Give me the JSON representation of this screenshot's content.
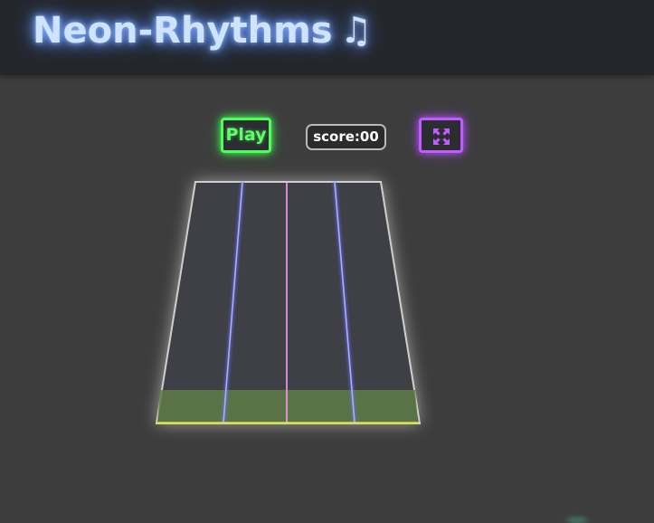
{
  "header": {
    "title": "Neon-Rhythms",
    "note_glyph": "♫"
  },
  "controls": {
    "play_label": "Play",
    "score_label": "score:00",
    "fullscreen_icon": "expand-arrows-icon"
  },
  "colors": {
    "background": "#3d3d3d",
    "header_bg": "#24262b",
    "title_glow": "#6b9cff",
    "play_accent": "#4cff5a",
    "fullscreen_accent": "#c25bff",
    "lane_line_blue": "#8a8dff",
    "lane_line_pink": "#ff7bf2",
    "hit_zone": "#5f7d47",
    "hit_line": "#d9e14a"
  },
  "highway": {
    "lanes": 4,
    "lane_line_colors": [
      "blue",
      "pink",
      "blue"
    ]
  }
}
